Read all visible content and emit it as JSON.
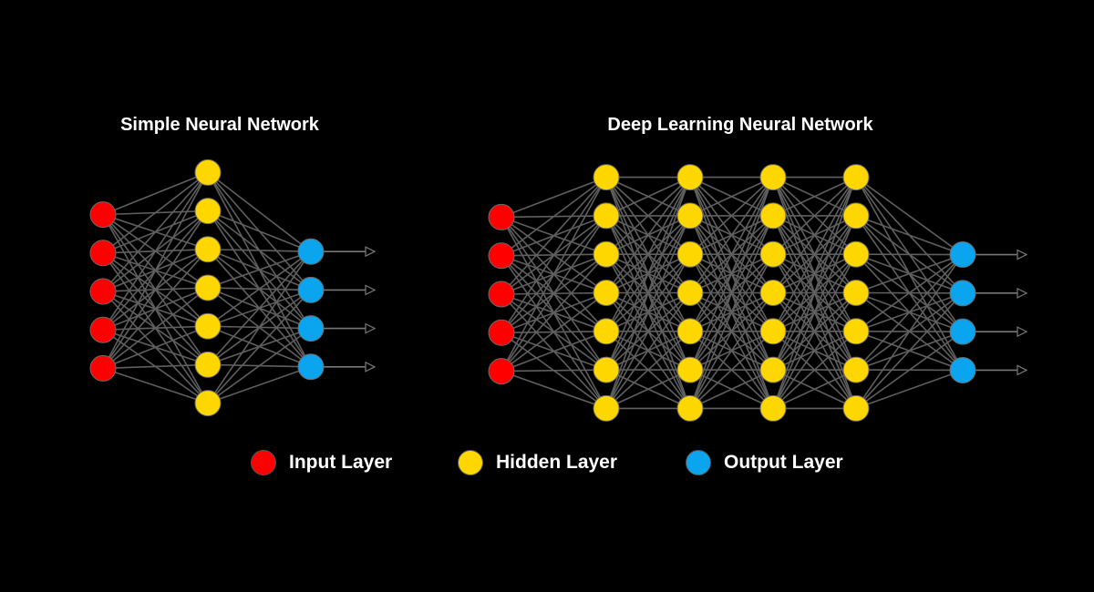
{
  "colors": {
    "background": "#000000",
    "input": "#ff0000",
    "hidden": "#ffd700",
    "output": "#0aa4ef",
    "edge": "#5f5f5f"
  },
  "simple": {
    "title": "Simple Neural Network",
    "layers": [
      {
        "type": "input",
        "count": 5
      },
      {
        "type": "hidden",
        "count": 7
      },
      {
        "type": "output",
        "count": 4
      }
    ]
  },
  "deep": {
    "title": "Deep Learning Neural Network",
    "layers": [
      {
        "type": "input",
        "count": 5
      },
      {
        "type": "hidden",
        "count": 7
      },
      {
        "type": "hidden",
        "count": 7
      },
      {
        "type": "hidden",
        "count": 7
      },
      {
        "type": "hidden",
        "count": 7
      },
      {
        "type": "output",
        "count": 4
      }
    ]
  },
  "legend": [
    {
      "type": "input",
      "label": "Input Layer"
    },
    {
      "type": "hidden",
      "label": "Hidden Layer"
    },
    {
      "type": "output",
      "label": "Output Layer"
    }
  ]
}
